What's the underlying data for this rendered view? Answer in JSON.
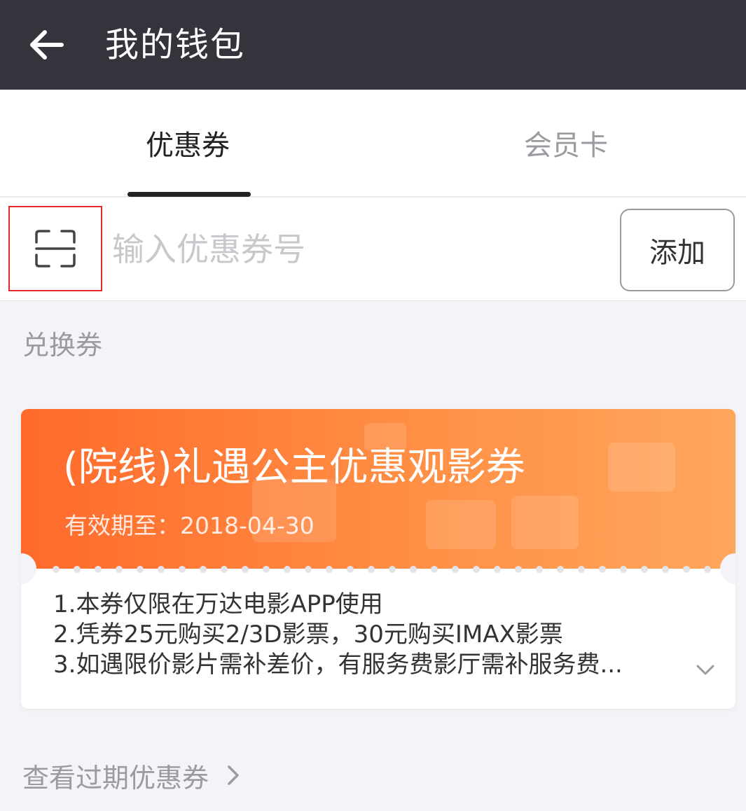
{
  "header": {
    "title": "我的钱包",
    "back_icon": "arrow-left-icon"
  },
  "tabs": [
    {
      "label": "优惠券",
      "active": true
    },
    {
      "label": "会员卡",
      "active": false
    }
  ],
  "coupon_input": {
    "placeholder": "输入优惠券号",
    "scan_icon": "scan-icon",
    "add_label": "添加"
  },
  "section": {
    "title": "兑换券"
  },
  "coupon": {
    "title": "(院线)礼遇公主优惠观影券",
    "expiry": "有效期至：2018-04-30",
    "rules": [
      "1.本券仅限在万达电影APP使用",
      "2.凭券25元购买2/3D影票，30元购买IMAX影票",
      "3.如遇限价影片需补差价，有服务费影厅需补服务费..."
    ],
    "expand_icon": "chevron-down-icon",
    "colors": {
      "gradient_start": "#ff6a2b",
      "gradient_end": "#ffa65d"
    }
  },
  "expired": {
    "label": "查看过期优惠券",
    "icon": "chevron-right-icon"
  },
  "colors": {
    "header_bg": "#35343d",
    "highlight_border": "#e02a2a",
    "page_bg": "#f4f4f8"
  }
}
